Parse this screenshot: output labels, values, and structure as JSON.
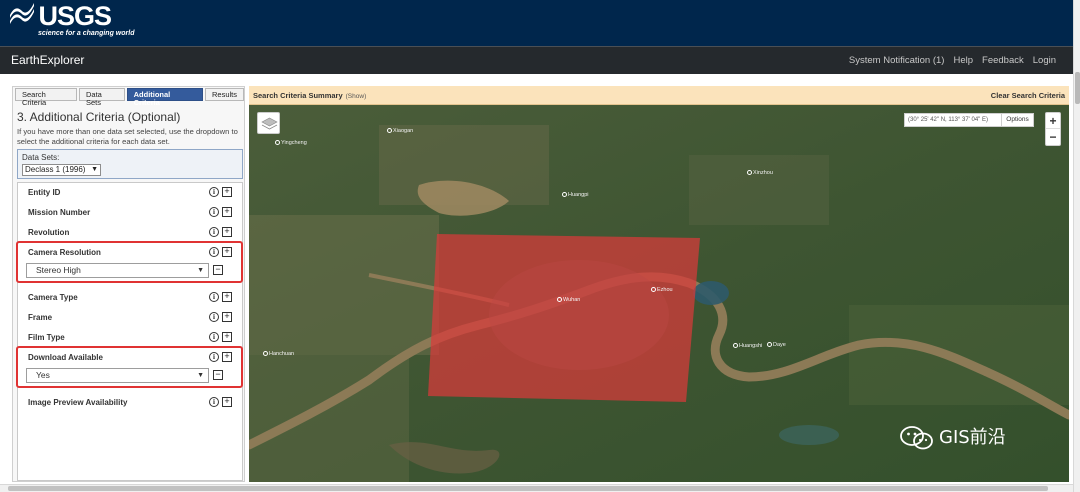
{
  "header": {
    "logo_word": "USGS",
    "logo_tagline": "science for a changing world",
    "app_title": "EarthExplorer",
    "nav": [
      "System Notification (1)",
      "Help",
      "Feedback",
      "Login"
    ]
  },
  "tabs": [
    {
      "label": "Search Criteria",
      "active": false
    },
    {
      "label": "Data Sets",
      "active": false
    },
    {
      "label": "Additional Criteria",
      "active": true
    },
    {
      "label": "Results",
      "active": false
    }
  ],
  "panel": {
    "title": "3. Additional Criteria (Optional)",
    "help": "If you have more than one data set selected, use the dropdown to select the additional criteria for each data set.",
    "datasets_label": "Data Sets:",
    "dataset_selected": "Declass 1 (1996)"
  },
  "criteria": [
    {
      "label": "Entity ID"
    },
    {
      "label": "Mission Number"
    },
    {
      "label": "Revolution"
    },
    {
      "label": "Camera Resolution",
      "value": "Stereo High"
    },
    {
      "label": "Camera Type"
    },
    {
      "label": "Frame"
    },
    {
      "label": "Film Type"
    },
    {
      "label": "Download Available",
      "value": "Yes"
    },
    {
      "label": "Image Preview Availability"
    }
  ],
  "map": {
    "summary_title": "Search Criteria Summary",
    "summary_show": "(Show)",
    "clear_label": "Clear Search Criteria",
    "coords": "(30° 25' 42\" N, 113° 37' 04\" E)",
    "options_label": "Options",
    "zoom_in": "+",
    "zoom_out": "−",
    "cities": [
      "Xiaogan",
      "Yingcheng",
      "Huangpi",
      "Xinzhou",
      "Wuhan",
      "Ezhou",
      "Hanchuan",
      "Huangshi",
      "Daye"
    ],
    "watermark": "GIS前沿"
  },
  "colors": {
    "usgs_navy": "#00264c",
    "app_bar": "#25292d",
    "active_tab": "#345b9c",
    "summary_bar": "#fbe3bb",
    "highlight": "#e03333",
    "aoi_fill": "#d93a3a"
  }
}
